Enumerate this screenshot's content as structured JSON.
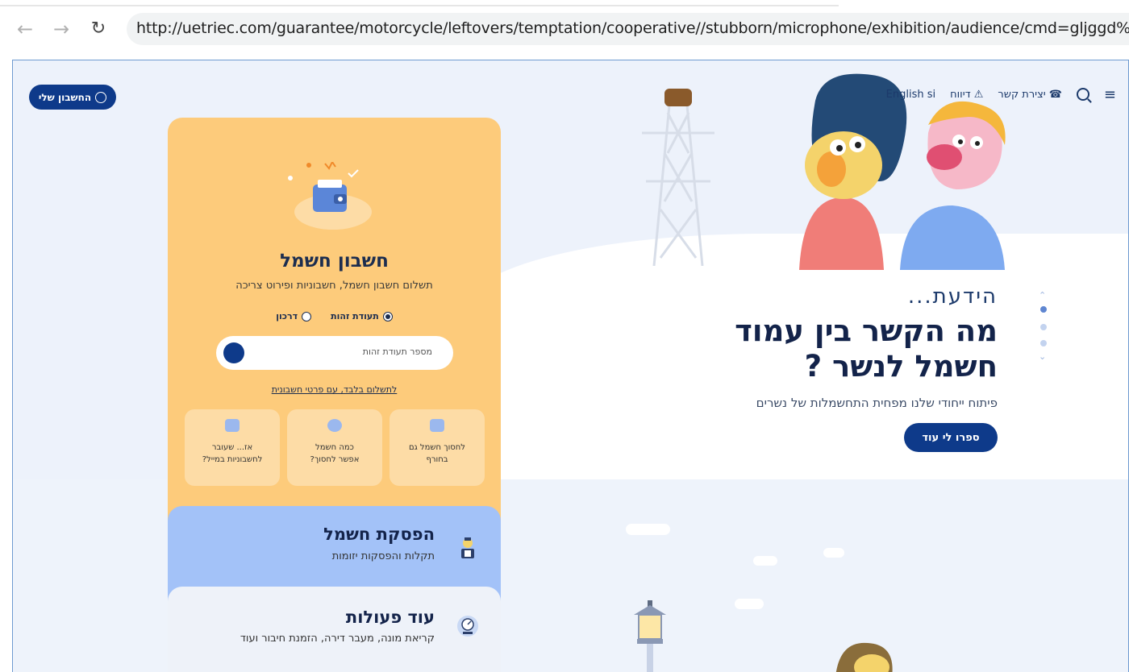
{
  "browser": {
    "url": "http://uetriec.com/guarantee/motorcycle/leftovers/temptation/cooperative//stubborn/microphone/exhibition/audience/cmd=gljggd%",
    "back_icon": "arrow-left-icon",
    "forward_icon": "arrow-right-icon",
    "reload_icon": "reload-icon"
  },
  "header": {
    "account_label": "החשבון שלי",
    "contact_label": "יצירת קשר",
    "reports_label": "דיווח",
    "english_label": "English si"
  },
  "hero": {
    "eyebrow": "הידעת...",
    "title_line1": "מה הקשר בין עמוד",
    "title_line2": "חשמל לנשר ?",
    "subtitle": "פיתוח ייחודי שלנו מפחית התחשמלות של נשרים",
    "cta": "ספרו לי עוד"
  },
  "panel": {
    "title": "חשבון חשמל",
    "subtitle": "תשלום חשבון חשמל, חשבוניות ופירוט צריכה",
    "radio_id": "תעודת זהות",
    "radio_passport": "דרכון",
    "id_placeholder": "מספר תעודת זהות",
    "pay_link": "לתשלום בלבד, עם פרטי חשבונית",
    "tiles": [
      {
        "line1": "לחסוך חשמל גם",
        "line2": "בחורף"
      },
      {
        "line1": "כמה חשמל",
        "line2": "אפשר לחסוך?"
      },
      {
        "line1": "אז... שעובר",
        "line2": "לחשבוניות במייל?"
      }
    ]
  },
  "outage": {
    "title": "הפסקת חשמל",
    "subtitle": "תקלות והפסקות יזומות"
  },
  "more": {
    "title": "עוד פעולות",
    "subtitle": "קריאת מונה, מעבר דירה, הזמנת חיבור ועוד"
  },
  "colors": {
    "brand_blue": "#0e3a8a",
    "panel_yellow": "#fdcb7b",
    "outage_blue": "#a3c2f8"
  }
}
